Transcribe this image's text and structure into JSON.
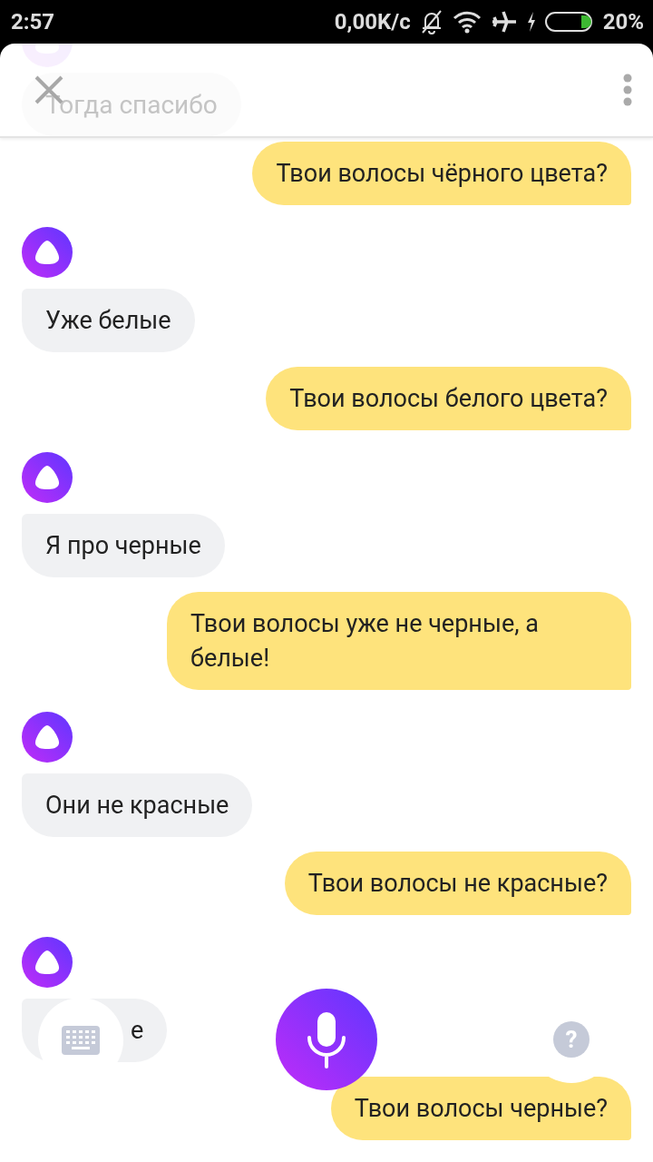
{
  "status_bar": {
    "time": "2:57",
    "speed": "0,00K/c",
    "battery": "20%"
  },
  "header": {
    "faded_message": "Тогда спасибо"
  },
  "messages": [
    {
      "kind": "user",
      "text": "Твои волосы чёрного цвета?"
    },
    {
      "kind": "bot",
      "text": "Уже белые"
    },
    {
      "kind": "user",
      "text": "Твои волосы белого цвета?"
    },
    {
      "kind": "bot",
      "text": "Я про черные"
    },
    {
      "kind": "user",
      "text": "Твои волосы уже не черные, а белые!"
    },
    {
      "kind": "bot",
      "text": "Они не красные"
    },
    {
      "kind": "user",
      "text": "Твои волосы не красные?"
    },
    {
      "kind": "bot",
      "text": "е",
      "covered": true
    },
    {
      "kind": "user",
      "text": "Твои волосы черные?"
    }
  ],
  "controls": {
    "help": "?"
  }
}
